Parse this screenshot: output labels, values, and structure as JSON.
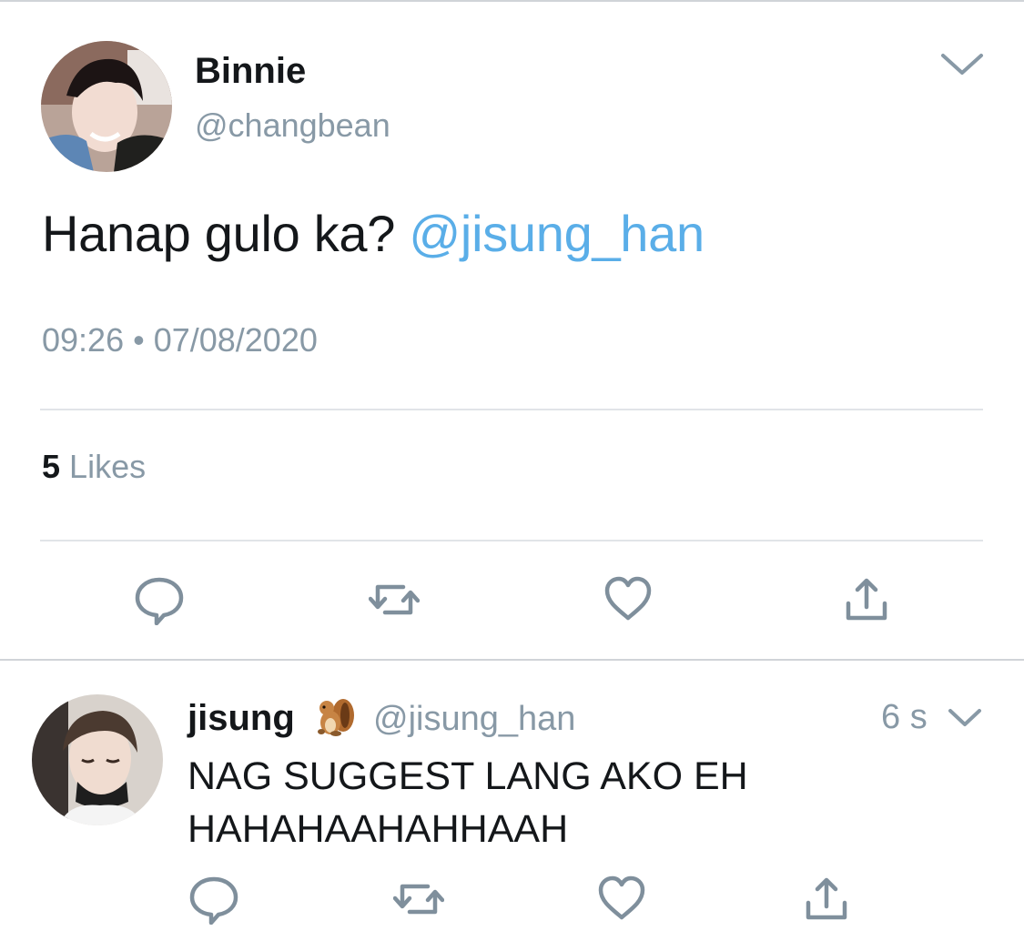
{
  "tweet": {
    "author_name": "Binnie",
    "author_handle": "@changbean",
    "text_plain": "Hanap gulo ka? ",
    "text_mention": "@jisung_han",
    "timestamp": "09:26 • 07/08/2020",
    "likes_count": "5",
    "likes_label": "Likes",
    "menu_icon": "chevron-down-icon"
  },
  "actions": [
    {
      "icon": "reply-icon"
    },
    {
      "icon": "retweet-icon"
    },
    {
      "icon": "like-icon"
    },
    {
      "icon": "share-icon"
    }
  ],
  "reply": {
    "author_name": "jisung",
    "author_emoji_icon": "chipmunk-icon",
    "author_handle": "@jisung_han",
    "time": "6 s",
    "line1": "NAG SUGGEST LANG AKO EH",
    "line2": "HAHAHAAHAHHAAH"
  },
  "colors": {
    "text": "#14171a",
    "secondary": "#8899a6",
    "mention": "#5aaee8",
    "divider": "#e1e4e8"
  }
}
